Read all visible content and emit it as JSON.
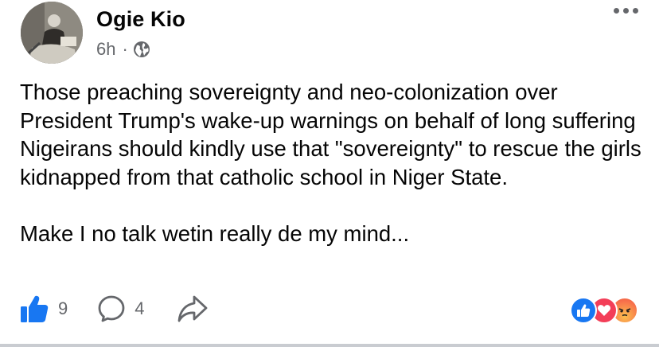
{
  "post": {
    "author": "Ogie Kio",
    "time": "6h",
    "separator": "·",
    "privacy_icon": "globe-icon",
    "body": "Those preaching sovereignty and neo-colonization over President Trump's wake-up warnings on behalf of long suffering Nigeirans should kindly use that \"sovereignty\" to rescue the girls kidnapped from that catholic school in Niger State.\n\nMake I no talk wetin really de my mind..."
  },
  "actions": {
    "like_count": "9",
    "comment_count": "4"
  },
  "reactions": [
    "like-reaction-icon",
    "love-reaction-icon",
    "angry-reaction-icon"
  ],
  "colors": {
    "like_blue": "#1877f2",
    "love_red": "#f33e58",
    "angry_orange": "#f7714c",
    "secondary_text": "#65676b"
  }
}
